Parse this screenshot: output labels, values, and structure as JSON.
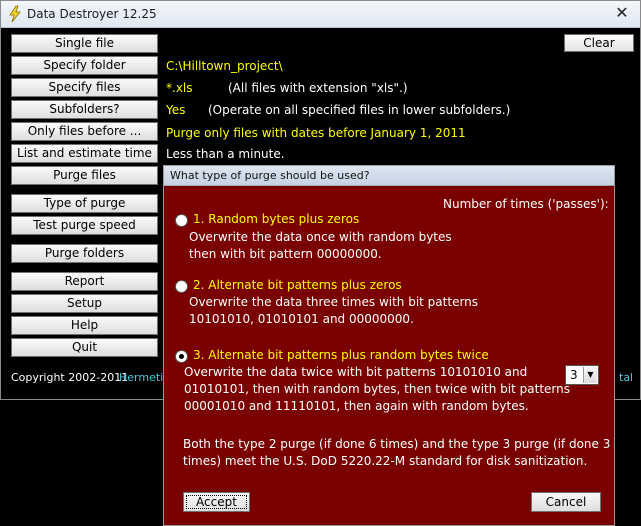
{
  "window": {
    "title": "Data Destroyer 12.25",
    "close_glyph": "✕"
  },
  "toolbar": {
    "clear_label": "Clear"
  },
  "sidebar": {
    "buttons": [
      "Single file",
      "Specify folder",
      "Specify files",
      "Subfolders?",
      "Only files before ...",
      "List and estimate time",
      "Purge files",
      "Type of purge",
      "Test purge speed",
      "Purge folders",
      "Report",
      "Setup",
      "Help",
      "Quit"
    ]
  },
  "info": {
    "folder": "C:\\Hilltown_project\\",
    "ext_value": "*.xls",
    "ext_desc": "(All files with extension \"xls\".)",
    "subfolders_value": "Yes",
    "subfolders_desc": "(Operate on all specified files in lower subfolders.)",
    "date_filter": "Purge only files with dates before January 1, 2011",
    "estimate": "Less than a minute."
  },
  "footer": {
    "copyright": "Copyright 2002-2011",
    "company": "Hermetic",
    "tail": "tal"
  },
  "dialog": {
    "title": "What type of purge should be used?",
    "passes_label": "Number of times ('passes'):",
    "options": [
      {
        "title": "1. Random bytes plus zeros",
        "lines": [
          "Overwrite the data once with random bytes",
          "then with bit pattern 00000000."
        ]
      },
      {
        "title": "2. Alternate bit patterns plus zeros",
        "lines": [
          "Overwrite the data three times with bit patterns",
          "10101010, 01010101 and 00000000."
        ]
      },
      {
        "title": "3. Alternate bit patterns plus random bytes twice",
        "lines": [
          "Overwrite the data twice with bit patterns 10101010 and",
          "01010101, then with random bytes, then twice with bit patterns",
          "00001010 and 11110101, then again with random bytes."
        ]
      }
    ],
    "selected_option": 3,
    "passes_value": "3",
    "note_lines": [
      "Both the type 2 purge (if done 6 times) and the type 3 purge (if done 3",
      "times) meet the U.S. DoD 5220.22-M standard for disk sanitization."
    ],
    "accept_label": "Accept",
    "cancel_label": "Cancel"
  },
  "colors": {
    "dialog_bg": "#7a0000",
    "highlight": "#ffff00",
    "info_text": "#ffff00",
    "link": "#4fc3d9"
  }
}
